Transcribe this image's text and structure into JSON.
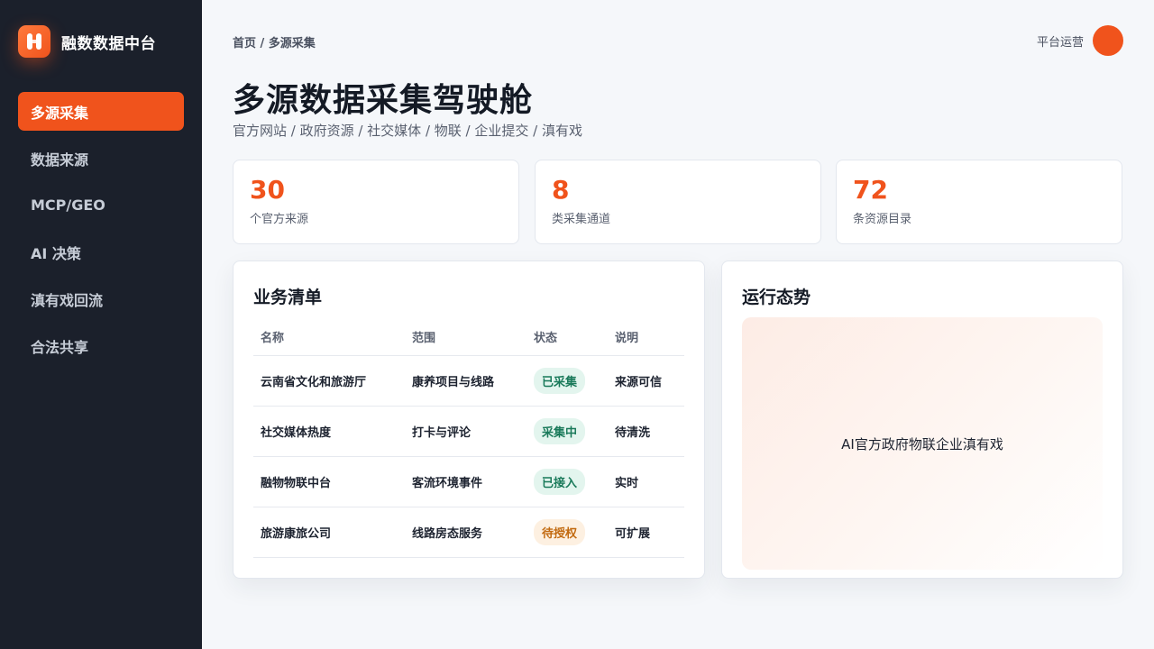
{
  "brand": {
    "name": "融数数据中台"
  },
  "nav": {
    "items": [
      {
        "label": "多源采集",
        "active": true
      },
      {
        "label": "数据来源"
      },
      {
        "label": "MCP/GEO"
      },
      {
        "label": "AI 决策"
      },
      {
        "label": "滇有戏回流"
      },
      {
        "label": "合法共享"
      }
    ]
  },
  "header": {
    "breadcrumb": "首页 / 多源采集",
    "user": "平台运营"
  },
  "page": {
    "title": "多源数据采集驾驶舱",
    "subtitle": "官方网站 / 政府资源 / 社交媒体 / 物联 / 企业提交 / 滇有戏"
  },
  "stats": [
    {
      "value": "30",
      "label": "个官方来源"
    },
    {
      "value": "8",
      "label": "类采集通道"
    },
    {
      "value": "72",
      "label": "条资源目录"
    }
  ],
  "business": {
    "title": "业务清单",
    "columns": [
      "名称",
      "范围",
      "状态",
      "说明"
    ],
    "rows": [
      {
        "name": "云南省文化和旅游厅",
        "scope": "康养项目与线路",
        "status": "已采集",
        "note": "来源可信"
      },
      {
        "name": "社交媒体热度",
        "scope": "打卡与评论",
        "status": "采集中",
        "note": "待清洗"
      },
      {
        "name": "融物物联中台",
        "scope": "客流环境事件",
        "status": "已接入",
        "note": "实时"
      },
      {
        "name": "旅游康旅公司",
        "scope": "线路房态服务",
        "status": "待授权",
        "note": "可扩展"
      }
    ]
  },
  "runtime": {
    "title": "运行态势",
    "text": "AI官方政府物联企业滇有戏"
  },
  "colors": {
    "accent": "#f0531c",
    "sidebar": "#1b202b",
    "success": "#1a7a5a",
    "warning": "#c26a10"
  }
}
